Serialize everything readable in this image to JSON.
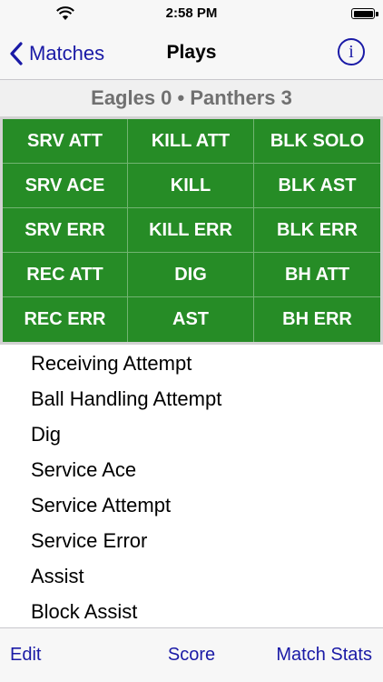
{
  "status_bar": {
    "time": "2:58 PM"
  },
  "nav": {
    "back_label": "Matches",
    "title": "Plays",
    "info_label": "i"
  },
  "score": "Eagles 0 • Panthers 3",
  "grid": [
    "SRV ATT",
    "KILL ATT",
    "BLK SOLO",
    "SRV ACE",
    "KILL",
    "BLK AST",
    "SRV ERR",
    "KILL ERR",
    "BLK ERR",
    "REC ATT",
    "DIG",
    "BH ATT",
    "REC ERR",
    "AST",
    "BH ERR"
  ],
  "plays": [
    "Receiving Attempt",
    "Ball Handling Attempt",
    "Dig",
    "Service Ace",
    "Service Attempt",
    "Service Error",
    "Assist",
    "Block Assist"
  ],
  "toolbar": {
    "edit": "Edit",
    "score": "Score",
    "match_stats": "Match Stats"
  },
  "colors": {
    "tint": "#1a1aa6",
    "grid_green": "#268c26",
    "score_text": "#707070"
  }
}
